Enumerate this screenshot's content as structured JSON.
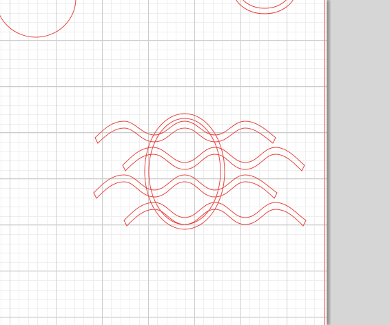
{
  "app": {
    "view": "cut-design-canvas"
  },
  "colors": {
    "grid_minor": "#eeeeee",
    "grid_major": "#cccccc",
    "cut_line": "#e8413c",
    "page_border": "#e8413c",
    "workspace_bg": "#d4d4d4",
    "page_bg": "#ffffff"
  },
  "canvas": {
    "grid_visible": true,
    "objects": [
      {
        "name": "partial-oval-top-left",
        "shape": "ellipse"
      },
      {
        "name": "partial-ring-top-right",
        "shape": "ellipse"
      },
      {
        "name": "wave-egg-design",
        "shape": "group"
      }
    ]
  }
}
